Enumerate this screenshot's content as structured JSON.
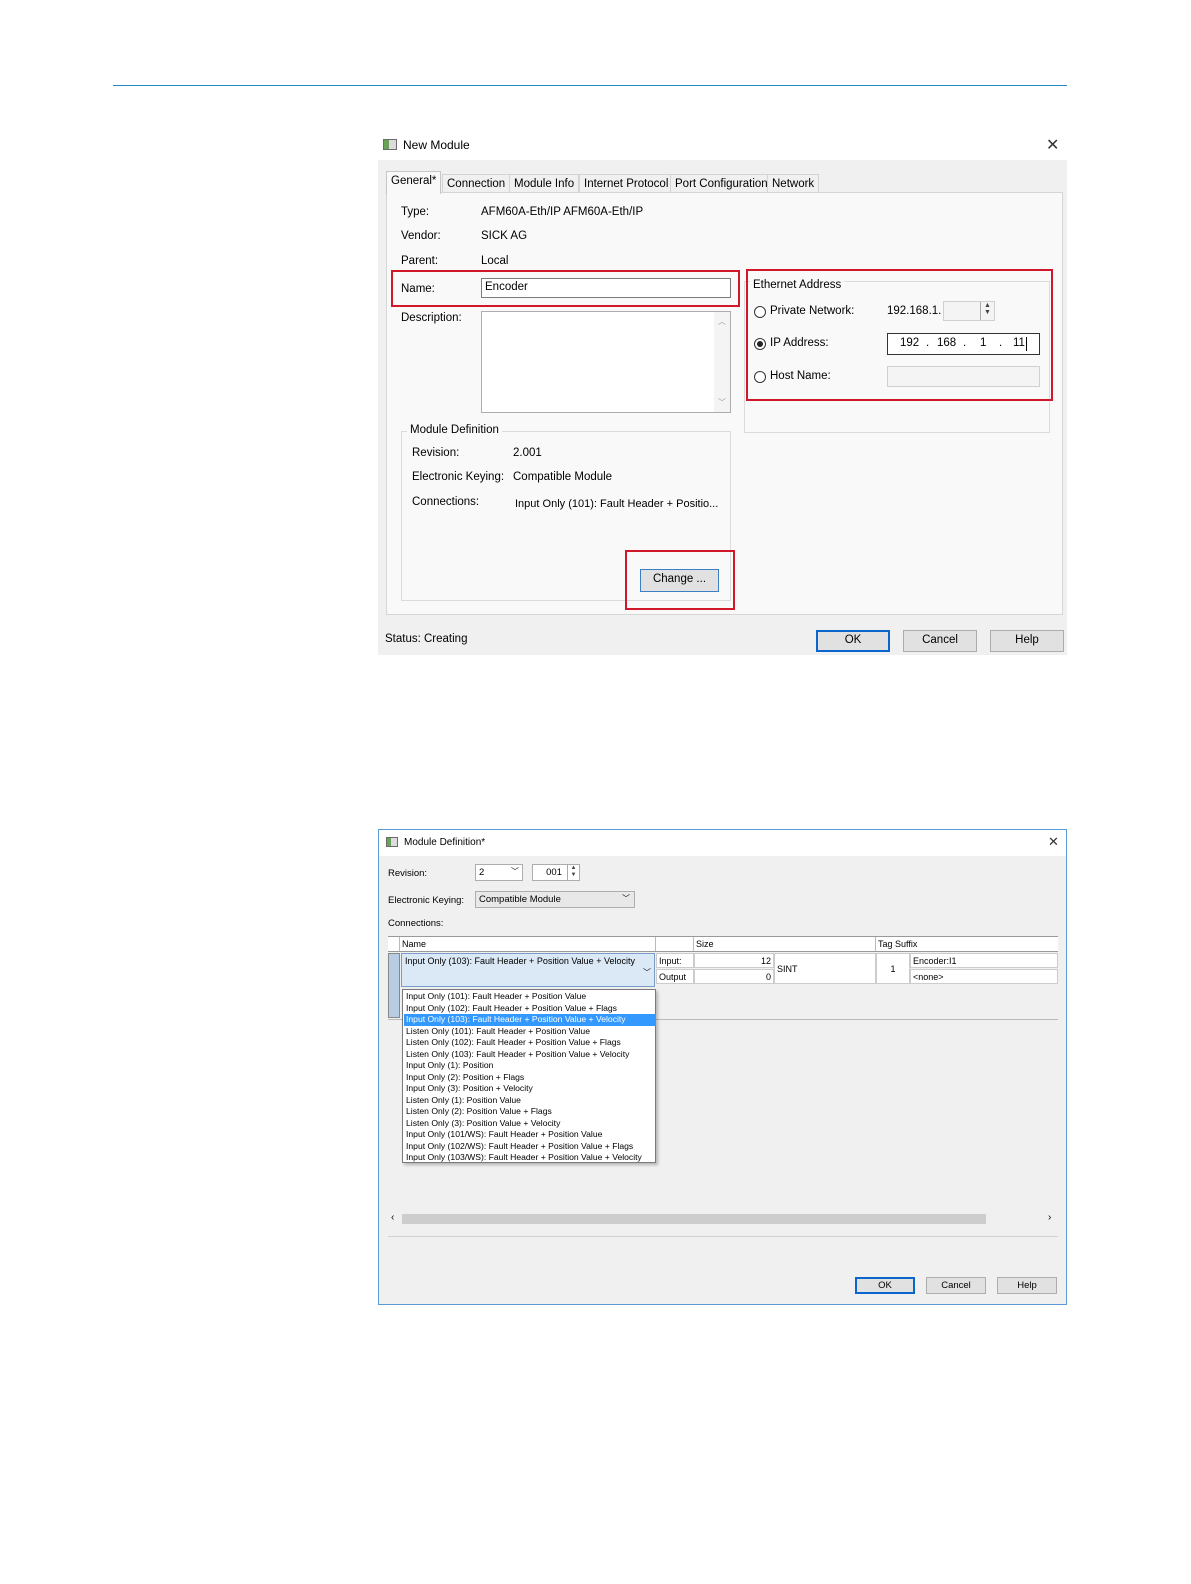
{
  "dialog1": {
    "title": "New Module",
    "close_glyph": "✕",
    "tabs": [
      "General*",
      "Connection",
      "Module Info",
      "Internet Protocol",
      "Port Configuration",
      "Network"
    ],
    "type_label": "Type:",
    "type_value": "AFM60A-Eth/IP AFM60A-Eth/IP",
    "vendor_label": "Vendor:",
    "vendor_value": "SICK AG",
    "parent_label": "Parent:",
    "parent_value": "Local",
    "name_label": "Name:",
    "name_value": "Encoder",
    "description_label": "Description:",
    "ethernet": {
      "title": "Ethernet Address",
      "private_label": "Private Network:",
      "private_prefix": "192.168.1.",
      "ip_label": "IP Address:",
      "ip": [
        "192",
        "168",
        "1",
        "11"
      ],
      "host_label": "Host Name:",
      "selected": "ip"
    },
    "module_def": {
      "title": "Module Definition",
      "revision_label": "Revision:",
      "revision_value": "2.001",
      "keying_label": "Electronic Keying:",
      "keying_value": "Compatible Module",
      "connections_label": "Connections:",
      "connections_value": "Input Only (101): Fault Header + Positio..."
    },
    "change_button": "Change ...",
    "status_text": "Status:  Creating",
    "ok": "OK",
    "cancel": "Cancel",
    "help": "Help"
  },
  "dialog2": {
    "title": "Module Definition*",
    "close_glyph": "✕",
    "revision_label": "Revision:",
    "revision_major": "2",
    "revision_minor": "001",
    "keying_label": "Electronic Keying:",
    "keying_value": "Compatible Module",
    "connections_label": "Connections:",
    "headers": {
      "name": "Name",
      "size": "Size",
      "tag_suffix": "Tag Suffix"
    },
    "selected_connection": "Input Only (103): Fault Header + Position Value + Velocity",
    "input_label": "Input:",
    "input_size": "12",
    "output_label": "Output",
    "output_size": "0",
    "data_type": "SINT",
    "tag_count": "1",
    "input_tag": "Encoder:I1",
    "output_tag": "<none>",
    "options": [
      "Input Only (101): Fault Header + Position Value",
      "Input Only (102): Fault Header + Position Value + Flags",
      "Input Only (103): Fault Header + Position Value + Velocity",
      "Listen Only (101): Fault Header + Position Value",
      "Listen Only (102): Fault Header + Position Value + Flags",
      "Listen Only (103): Fault Header + Position Value + Velocity",
      "Input Only (1): Position",
      "Input Only (2): Position + Flags",
      "Input Only (3): Position + Velocity",
      "Listen Only (1): Position Value",
      "Listen Only (2): Position Value + Flags",
      "Listen Only (3): Position Value + Velocity",
      "Input Only (101/WS): Fault Header + Position Value",
      "Input Only (102/WS): Fault Header + Position Value + Flags",
      "Input Only (103/WS): Fault Header + Position Value + Velocity"
    ],
    "selected_option_index": 2,
    "ok": "OK",
    "cancel": "Cancel",
    "help": "Help"
  },
  "colors": {
    "accent": "#1e88c8",
    "highlight": "#d0182a",
    "selection": "#3399ff"
  }
}
